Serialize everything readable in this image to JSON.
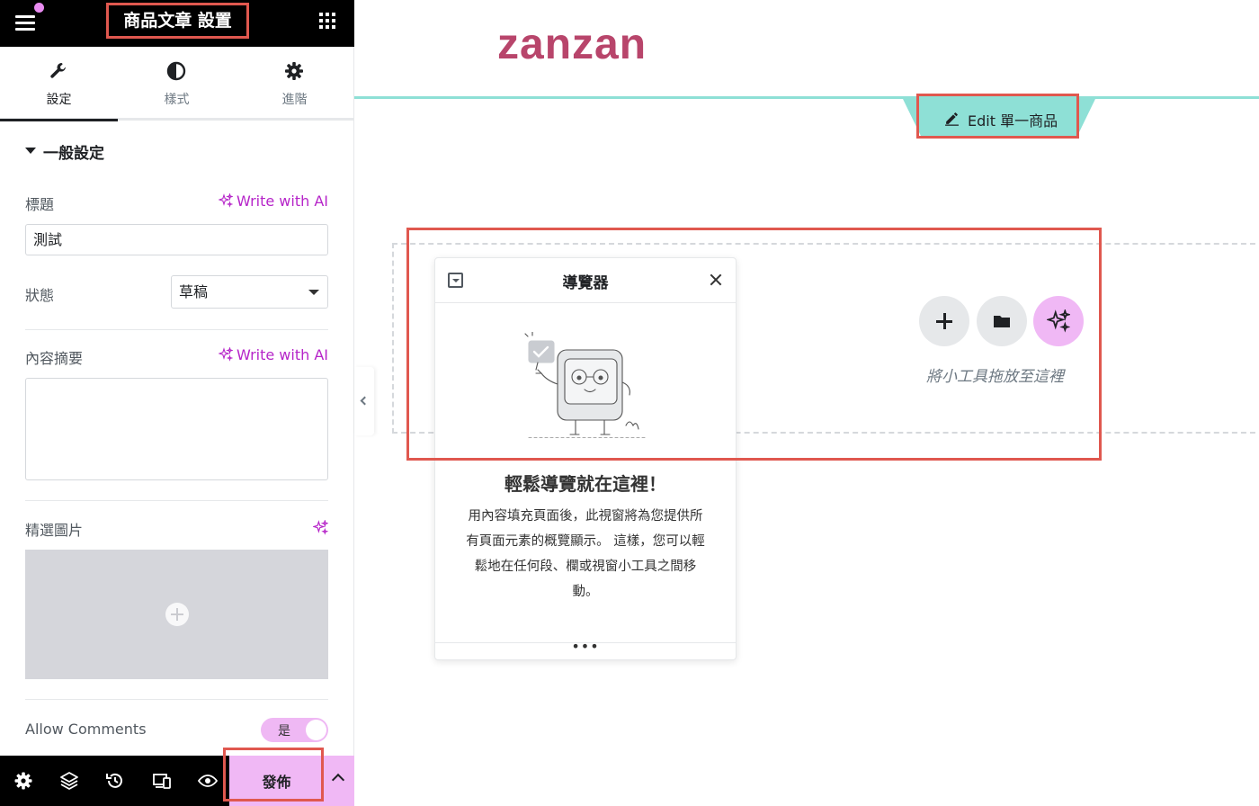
{
  "panel": {
    "title": "商品文章 設置",
    "tabs": [
      {
        "label": "設定",
        "icon": "wrench-icon",
        "active": true
      },
      {
        "label": "樣式",
        "icon": "contrast-icon",
        "active": false
      },
      {
        "label": "進階",
        "icon": "gear-icon",
        "active": false
      }
    ],
    "section_title": "一般設定",
    "fields": {
      "title_label": "標題",
      "title_value": "測試",
      "status_label": "狀態",
      "status_value": "草稿",
      "excerpt_label": "內容摘要",
      "excerpt_value": "",
      "featured_image_label": "精選圖片",
      "allow_comments_label": "Allow Comments",
      "allow_comments_value": "是"
    },
    "ai_link": "Write with AI",
    "bottom_bar": {
      "publish_label": "發佈",
      "icons": [
        "gear-icon",
        "layers-icon",
        "history-icon",
        "responsive-icon",
        "eye-icon",
        "chevron-up-icon"
      ]
    }
  },
  "canvas": {
    "site_logo": "zanzan",
    "edit_label": "Edit 單一商品",
    "drop_hint": "將小工具拖放至這裡",
    "navigator": {
      "title": "導覽器",
      "heading": "輕鬆導覽就在這裡！",
      "description": "用內容填充頁面後，此視窗將為您提供所有頁面元素的概覽顯示。 這樣，您可以輕鬆地在任何段、欄或視窗小工具之間移動。",
      "footer": "•••"
    }
  },
  "colors": {
    "accent_pink": "#f0b8f5",
    "ai_purple": "#b625c9",
    "logo": "#b8456b",
    "teal": "#8ee0d6",
    "highlight_red": "#e0584f"
  }
}
